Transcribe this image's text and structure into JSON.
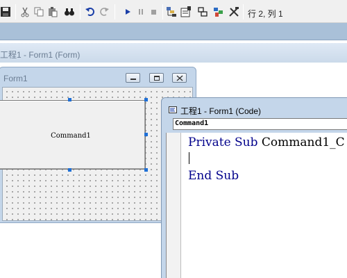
{
  "toolbar": {
    "status": "行 2, 列 1",
    "icons": [
      "save-icon",
      "cut-icon",
      "copy-icon",
      "paste-icon",
      "find-icon",
      "undo-icon",
      "redo-icon",
      "run-icon",
      "pause-icon",
      "stop-icon",
      "project-explorer-icon",
      "properties-icon",
      "form-layout-icon",
      "object-browser-icon",
      "toolbox-icon"
    ]
  },
  "designer": {
    "title": "工程1 - Form1 (Form)"
  },
  "form": {
    "title": "Form1",
    "command_caption": "Command1"
  },
  "code_window": {
    "title": "工程1 - Form1 (Code)",
    "object_combo": "Command1",
    "lines": [
      {
        "keyword": "Private Sub",
        "rest": " Command1_C"
      },
      {
        "keyword": "",
        "rest": ""
      },
      {
        "keyword": "End Sub",
        "rest": ""
      }
    ]
  },
  "colors": {
    "keyword": "#00008b",
    "selection_handle": "#1e6fd6",
    "title_bar": "#c4d6ea"
  }
}
